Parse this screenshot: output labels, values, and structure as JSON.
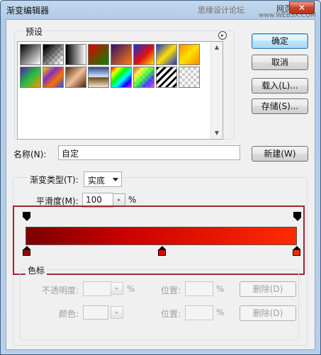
{
  "window": {
    "title": "渐变编辑器",
    "watermark_main": "思缘设计论坛",
    "watermark_url": "www.WEB3X.COM",
    "watermark_badge": "网页教学网",
    "close_label": "✕"
  },
  "presets": {
    "label": "预设",
    "menu_icon": "▸",
    "scroll_up": "▲",
    "scroll_down": "▼",
    "swatches": [
      {
        "name": "preset-black-white",
        "css": "linear-gradient(135deg,#000,#fff)"
      },
      {
        "name": "preset-black-transparent",
        "css": "linear-gradient(135deg,#000 10%,rgba(0,0,0,0) 90%),repeating-conic-gradient(#ccc 0% 25%,#fff 0% 50%) 0 0/8px 8px"
      },
      {
        "name": "preset-black-white-2",
        "css": "linear-gradient(90deg,#000,#fff)"
      },
      {
        "name": "preset-red-green",
        "css": "linear-gradient(135deg,#e00000,#008a00)"
      },
      {
        "name": "preset-violet-orange",
        "css": "linear-gradient(135deg,#30106a,#ff7a10)"
      },
      {
        "name": "preset-blue-red-yellow",
        "css": "linear-gradient(135deg,#1a2fd6,#e11010 55%,#ffe000)"
      },
      {
        "name": "preset-blue-yellow-blue",
        "css": "linear-gradient(135deg,#1530d8,#ffe000 50%,#1530d8)"
      },
      {
        "name": "preset-orange-yellow-orange",
        "css": "linear-gradient(135deg,#ff8a00,#ffe000 50%,#ff8a00)"
      },
      {
        "name": "preset-violet-green-orange",
        "css": "linear-gradient(135deg,#5a1ab0,#20c040 50%,#ff9010)"
      },
      {
        "name": "preset-yellow-violet-orange-blue",
        "css": "linear-gradient(135deg,#ffd000,#8030c0 35%,#ff7000 65%,#2050e0)"
      },
      {
        "name": "preset-copper",
        "css": "linear-gradient(135deg,#5a2a10,#f2c09a 50%,#4a1f0a)"
      },
      {
        "name": "preset-chrome",
        "css": "linear-gradient(180deg,#2a4a88,#d8e6ff 48%,#6a4a20 52%,#f6e8c8)"
      },
      {
        "name": "preset-spectrum",
        "css": "linear-gradient(135deg,#ff0000,#ffff00 20%,#00ff00 40%,#00ffff 60%,#0000ff 80%,#ff00ff)"
      },
      {
        "name": "preset-transparent-rainbow",
        "css": "linear-gradient(135deg,rgba(255,0,0,.7),rgba(255,255,0,.7) 25%,rgba(0,255,0,.7) 50%,rgba(0,0,255,.7) 75%,rgba(255,0,255,.7)),repeating-conic-gradient(#ccc 0% 25%,#fff 0% 50%) 0 0/8px 8px"
      },
      {
        "name": "preset-transparent-stripes",
        "css": "repeating-linear-gradient(135deg,#000 0 3px,#fff 3px 7px)"
      },
      {
        "name": "preset-transparent",
        "css": "repeating-conic-gradient(#ccc 0% 25%,#fff 0% 50%) 0 0/8px 8px"
      }
    ]
  },
  "buttons": {
    "ok": "确定",
    "cancel": "取消",
    "load": "载入(L)...",
    "save": "存储(S)...",
    "new": "新建(W)",
    "delete_opacity": "删除(D)",
    "delete_color": "删除(D)"
  },
  "name_field": {
    "label": "名称(N):",
    "value": "自定"
  },
  "gradient": {
    "group_label": "",
    "type_label": "渐变类型(T):",
    "type_value": "实底",
    "smoothness_label": "平滑度(M):",
    "smoothness_value": "100",
    "smoothness_unit": "%",
    "stepper_icon": "▸",
    "colors": {
      "start": "#7a0000",
      "mid": "#c80000",
      "end": "#ff2a00"
    },
    "color_stops": [
      {
        "position": 0,
        "color": "#9a0000"
      },
      {
        "position": 50,
        "color": "#e30000"
      },
      {
        "position": 100,
        "color": "#ff2a00"
      }
    ],
    "opacity_stops": [
      {
        "position": 0,
        "opacity": 100
      },
      {
        "position": 100,
        "opacity": 100
      }
    ]
  },
  "stops_panel": {
    "label": "色标",
    "opacity_label": "不透明度:",
    "opacity_unit": "%",
    "location_label": "位置:",
    "location_unit": "%",
    "color_label": "颜色:",
    "location_label2": "位置:",
    "location_unit2": "%",
    "stepper_icon": "▸"
  },
  "annotation": {
    "highlight_color": "#a3262e"
  }
}
